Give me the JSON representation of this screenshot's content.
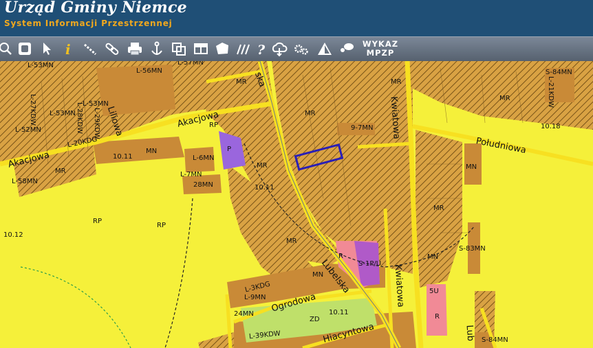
{
  "header": {
    "title": "Urząd Gminy Niemce",
    "subtitle": "System Informacji Przestrzennej",
    "colors": {
      "background": "#1f4f76",
      "title": "#ffffff",
      "subtitle": "#f0a81e"
    }
  },
  "toolbar": {
    "tools": [
      "zoom-icon",
      "zoom-extent-icon",
      "pointer-icon",
      "info-icon",
      "measure-icon",
      "link-icon",
      "print-icon",
      "anchor-icon",
      "layers-icon",
      "layout-icon",
      "area-icon",
      "hatch-icon",
      "help-icon",
      "cloud-download-icon",
      "settings-icon",
      "warning-icon",
      "comment-icon"
    ],
    "wykaz_line1": "WYKAZ",
    "wykaz_line2": "MPZP"
  },
  "map": {
    "colors": {
      "rp_yellow": "#f5f03a",
      "mr_orange": "#d9a243",
      "mn_brown": "#c98a37",
      "p_purple": "#9a66dd",
      "u_pink": "#f18a96",
      "zd_green": "#bfe06a",
      "road": "#f7e021",
      "selection": "#2a1fb5"
    },
    "streets": {
      "akacjowa_1": "Akacjowa",
      "akacjowa_2": "Akacjowa",
      "liliowa": "Liliowa",
      "lubelska_top": "ska",
      "lubelska": "Lubelska",
      "kwiatowa_top": "Kwiatowa",
      "kwiatowa": "Kwiatowa",
      "poludniowa": "Południowa",
      "ogrodowa": "Ogrodowa",
      "jacyntowa": "Hiacyntowa",
      "lub_right": "Lub"
    },
    "labels": {
      "l53mn_top": "L-53MN",
      "l56mn": "L-56MN",
      "l57mn": "L-57MN",
      "mr_1": "MR",
      "mr_2": "MR",
      "mr_3": "MR",
      "mr_4": "MR",
      "mr_5": "MR",
      "mr_6": "MR",
      "mr_7": "MR",
      "mr_8": "MR",
      "mr_9": "MR",
      "mr_10": "MR",
      "mr_11": "MR",
      "l27kdw": "L-27KDW",
      "l53mn": "L-53MN",
      "l53mn_b": "L-53MN",
      "l28kdw": "L-28KDW",
      "l29kdw": "L-29KDW",
      "l20kdg": "L-20KDG",
      "l52mn": "L-52MN",
      "l21kdw": "L-21KDW",
      "s84mn": "S-84MN",
      "n9_7mn": "9-7MN",
      "n10_18": "10.18",
      "n10_11_a": "10.11",
      "n10_11_b": "10.11",
      "n10_11_c": "10.11",
      "mn_1": "MN",
      "mn_2": "MN",
      "mn_3": "MN",
      "mn_4": "MN",
      "mn_5": "MN",
      "mn_6": "MN",
      "rp_1": "RP",
      "rp_2": "RP",
      "rp_3": "RP",
      "p": "P",
      "l6mn": "L-6MN",
      "l7mn": "L-7MN",
      "l58mn": "L-58MN",
      "l28mn": "28MN",
      "n10_12": "10.12",
      "r_1": "R",
      "r_2": "R",
      "s1pu": "S-1P/U",
      "s83mn": "S-83MN",
      "u5": "5U",
      "zd": "ZD",
      "l9mn": "L-9MN",
      "l24mn": "24MN",
      "l39kdw": "L-39KDW",
      "s84mn_b": "S-84MN",
      "ukd": "L-3KDG",
      "n10_11_d": "10.11"
    }
  }
}
